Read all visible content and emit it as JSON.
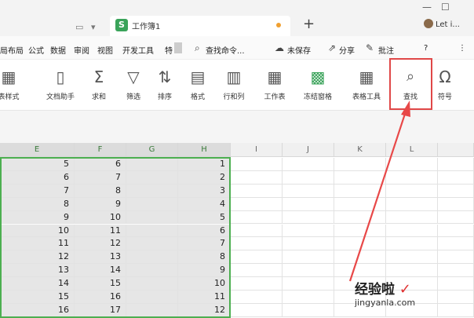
{
  "titlebar": {
    "doc_tab": "工作簿1",
    "user_label": "Let i...",
    "window_buttons": [
      "—",
      "☐"
    ]
  },
  "menubar": {
    "items": [
      "局布局",
      "公式",
      "数据",
      "审阅",
      "视图",
      "开发工具",
      "特"
    ],
    "search": "查找命令...",
    "save_status": "未保存",
    "share": "分享",
    "comment": "批注",
    "help": "?",
    "more": "⋮"
  },
  "ribbon": {
    "buttons": [
      {
        "icon": "table-style-icon",
        "glyph": "▦",
        "label": "表样式"
      },
      {
        "icon": "doc-helper-icon",
        "glyph": "🗎",
        "label": "文档助手"
      },
      {
        "icon": "sum-icon",
        "glyph": "Σ",
        "label": "求和"
      },
      {
        "icon": "filter-icon",
        "glyph": "⛛",
        "label": "筛选"
      },
      {
        "icon": "sort-icon",
        "glyph": "⇅",
        "label": "排序"
      },
      {
        "icon": "format-icon",
        "glyph": "▤",
        "label": "格式"
      },
      {
        "icon": "row-col-icon",
        "glyph": "▥",
        "label": "行和列"
      },
      {
        "icon": "worksheet-icon",
        "glyph": "▦",
        "label": "工作表"
      },
      {
        "icon": "freeze-pane-icon",
        "glyph": "▩",
        "label": "冻结窗格"
      },
      {
        "icon": "table-tools-icon",
        "glyph": "▦",
        "label": "表格工具"
      },
      {
        "icon": "find-icon",
        "glyph": "🔍",
        "label": "查找"
      },
      {
        "icon": "symbol-icon",
        "glyph": "Ω",
        "label": "符号"
      }
    ]
  },
  "sheet": {
    "columns": [
      "E",
      "F",
      "G",
      "H",
      "I",
      "J",
      "K",
      "L"
    ],
    "rows": [
      {
        "E": "5",
        "F": "6",
        "H": "1"
      },
      {
        "E": "6",
        "F": "7",
        "H": "2"
      },
      {
        "E": "7",
        "F": "8",
        "H": "3"
      },
      {
        "E": "8",
        "F": "9",
        "H": "4"
      },
      {
        "E": "9",
        "F": "10",
        "H": "5"
      },
      {
        "E": "10",
        "F": "11",
        "H": "6"
      },
      {
        "E": "11",
        "F": "12",
        "H": "7"
      },
      {
        "E": "12",
        "F": "13",
        "H": "8"
      },
      {
        "E": "13",
        "F": "14",
        "H": "9"
      },
      {
        "E": "14",
        "F": "15",
        "H": "10"
      },
      {
        "E": "15",
        "F": "16",
        "H": "11"
      },
      {
        "E": "16",
        "F": "17",
        "H": "12"
      }
    ]
  },
  "watermark": {
    "title": "经验啦",
    "url": "jingyanla.com"
  },
  "colors": {
    "selection": "#4caf50",
    "highlight": "#e04848"
  }
}
